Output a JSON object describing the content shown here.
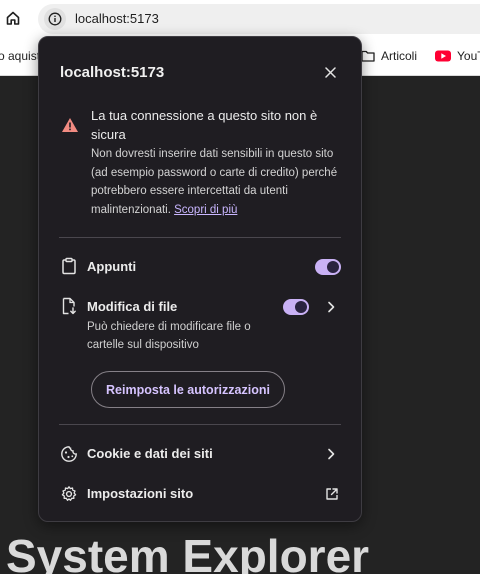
{
  "browser": {
    "url": "localhost:5173",
    "bookmarks": [
      {
        "label": "o aquisti",
        "icon": "none"
      },
      {
        "label": "Articoli",
        "icon": "folder-icon"
      },
      {
        "label": "YouT",
        "icon": "youtube-icon"
      }
    ]
  },
  "page": {
    "heading": "System Explorer"
  },
  "popup": {
    "title": "localhost:5173",
    "warning": {
      "heading": "La tua connessione a questo sito non è sicura",
      "body": "Non dovresti inserire dati sensibili in questo sito (ad esempio password o carte di credito) perché potrebbero essere intercettati da utenti malintenzionati.",
      "link": "Scopri di più"
    },
    "permissions": [
      {
        "label": "Appunti",
        "enabled": true
      },
      {
        "label": "Modifica di file",
        "description": "Può chiedere di modificare file o cartelle sul dispositivo",
        "enabled": true
      }
    ],
    "reset_label": "Reimposta le autorizzazioni",
    "links": [
      {
        "label": "Cookie e dati dei siti"
      },
      {
        "label": "Impostazioni sito"
      }
    ]
  },
  "colors": {
    "accent": "#c9b1f5",
    "link": "#c9b6ff",
    "popup_bg": "#1f1d22",
    "warning": "#f28b82"
  }
}
